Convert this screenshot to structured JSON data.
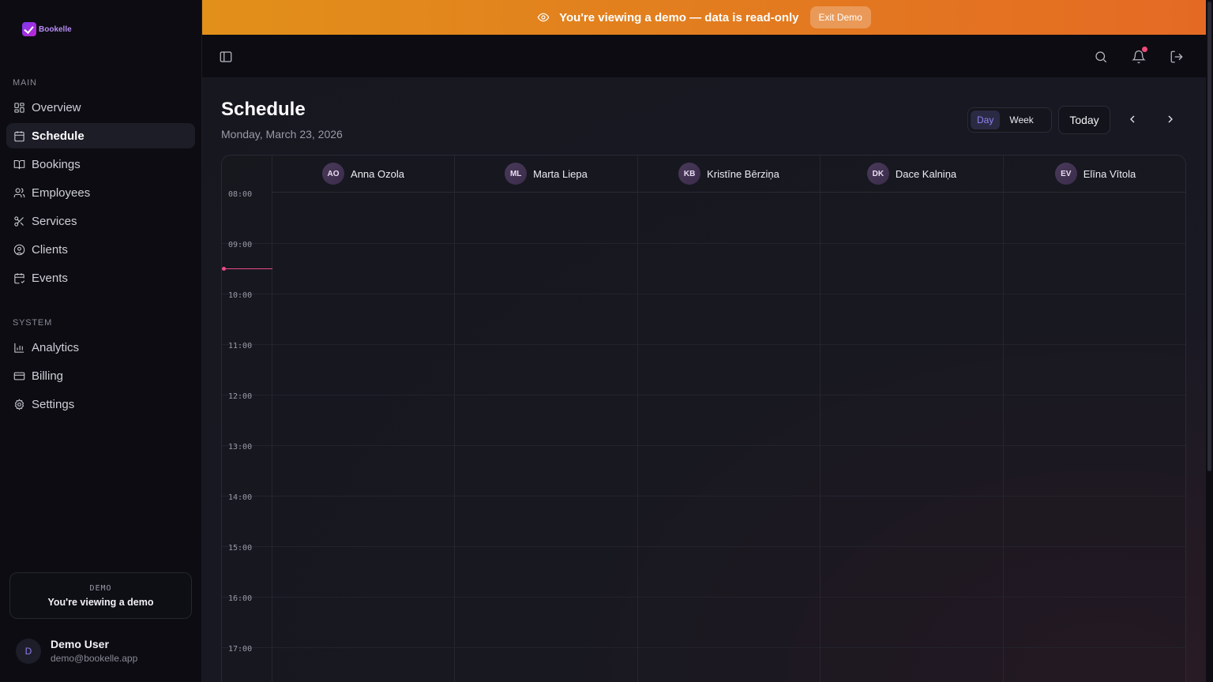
{
  "app": {
    "logo_text": "Bookelle"
  },
  "banner": {
    "text": "You're viewing a demo — data is read-only",
    "exit_label": "Exit Demo"
  },
  "sidebar": {
    "main_label": "MAIN",
    "system_label": "SYSTEM",
    "main_items": [
      {
        "label": "Overview",
        "icon": "grid-icon"
      },
      {
        "label": "Schedule",
        "icon": "calendar-icon",
        "active": true
      },
      {
        "label": "Bookings",
        "icon": "book-icon"
      },
      {
        "label": "Employees",
        "icon": "users-icon"
      },
      {
        "label": "Services",
        "icon": "scissors-icon"
      },
      {
        "label": "Clients",
        "icon": "user-circle-icon"
      },
      {
        "label": "Events",
        "icon": "calendar-check-icon"
      }
    ],
    "system_items": [
      {
        "label": "Analytics",
        "icon": "bar-chart-icon"
      },
      {
        "label": "Billing",
        "icon": "credit-card-icon"
      },
      {
        "label": "Settings",
        "icon": "gear-icon"
      }
    ],
    "demo_card": {
      "tag": "DEMO",
      "message": "You're viewing a demo"
    },
    "user": {
      "initial": "D",
      "name": "Demo User",
      "email": "demo@bookelle.app"
    }
  },
  "page": {
    "title": "Schedule",
    "date": "Monday, March 23, 2026",
    "view_day": "Day",
    "view_week": "Week",
    "today_label": "Today"
  },
  "schedule": {
    "employees": [
      {
        "initials": "AO",
        "name": "Anna Ozola"
      },
      {
        "initials": "ML",
        "name": "Marta Liepa"
      },
      {
        "initials": "KB",
        "name": "Kristīne Bērziņa"
      },
      {
        "initials": "DK",
        "name": "Dace Kalniņa"
      },
      {
        "initials": "EV",
        "name": "Elīna Vītola"
      }
    ],
    "hours": [
      "08:00",
      "09:00",
      "10:00",
      "11:00",
      "12:00",
      "13:00",
      "14:00",
      "15:00",
      "16:00",
      "17:00"
    ]
  },
  "colors": {
    "accent": "#8e82f0",
    "banner_start": "#e1901a",
    "banner_end": "#e46a24",
    "now_line": "#ec4a86"
  }
}
